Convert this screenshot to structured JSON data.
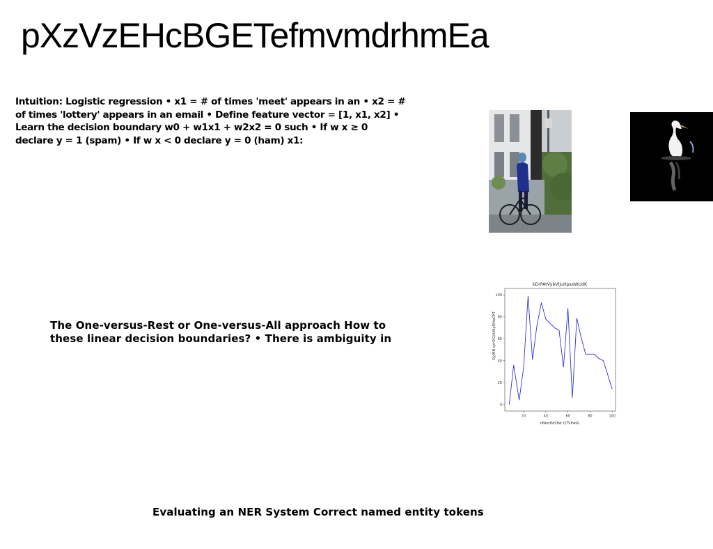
{
  "slide": {
    "title": "pXzVzEHcBGETefmvmdrhmEa",
    "paragraph_1": "Intuition: Logistic regression • x1 = # of times 'meet' appears in an • x2 = # of times 'lottery' appears in an email • Define feature vector = [1, x1, x2] • Learn the decision boundary w0 + w1x1 + w2x2 = 0 such • If w x ≥ 0 declare y = 1 (spam) • If w x < 0 declare y = 0 (ham) x1:",
    "paragraph_2": "The One-versus-Rest or One-versus-All approach How to these linear decision boundaries? • There is ambiguity in",
    "paragraph_3": "Evaluating an NER System Correct named entity tokens"
  },
  "images": {
    "street_photo": "photo of a person on a bicycle in a street",
    "bird_photo": "white heron on black water with reflection"
  },
  "chart_data": {
    "type": "line",
    "title": "kDrPAtVybVljuHpsxWUdK",
    "xlabel": "nNkoYktONr QTVPwIG",
    "ylabel": "OyjMN sjrHXGiAMujRHwOXT",
    "xlim": [
      3,
      103
    ],
    "ylim": [
      -6,
      106
    ],
    "xticks": [
      20,
      40,
      60,
      80,
      100
    ],
    "yticks": [
      0,
      20,
      40,
      60,
      80,
      100
    ],
    "grid": false,
    "series": [
      {
        "color": "#3333cc",
        "x": [
          7,
          11,
          16,
          20,
          24,
          28,
          32,
          36,
          40,
          44,
          48,
          52,
          56,
          60,
          64,
          68,
          72,
          76,
          80,
          84,
          88,
          92,
          96,
          100
        ],
        "y": [
          0,
          36,
          4,
          34,
          99,
          41,
          72,
          93,
          78,
          74,
          70,
          68,
          34,
          88,
          6,
          79,
          61,
          46,
          46,
          46,
          42,
          40,
          27,
          14
        ]
      }
    ]
  }
}
